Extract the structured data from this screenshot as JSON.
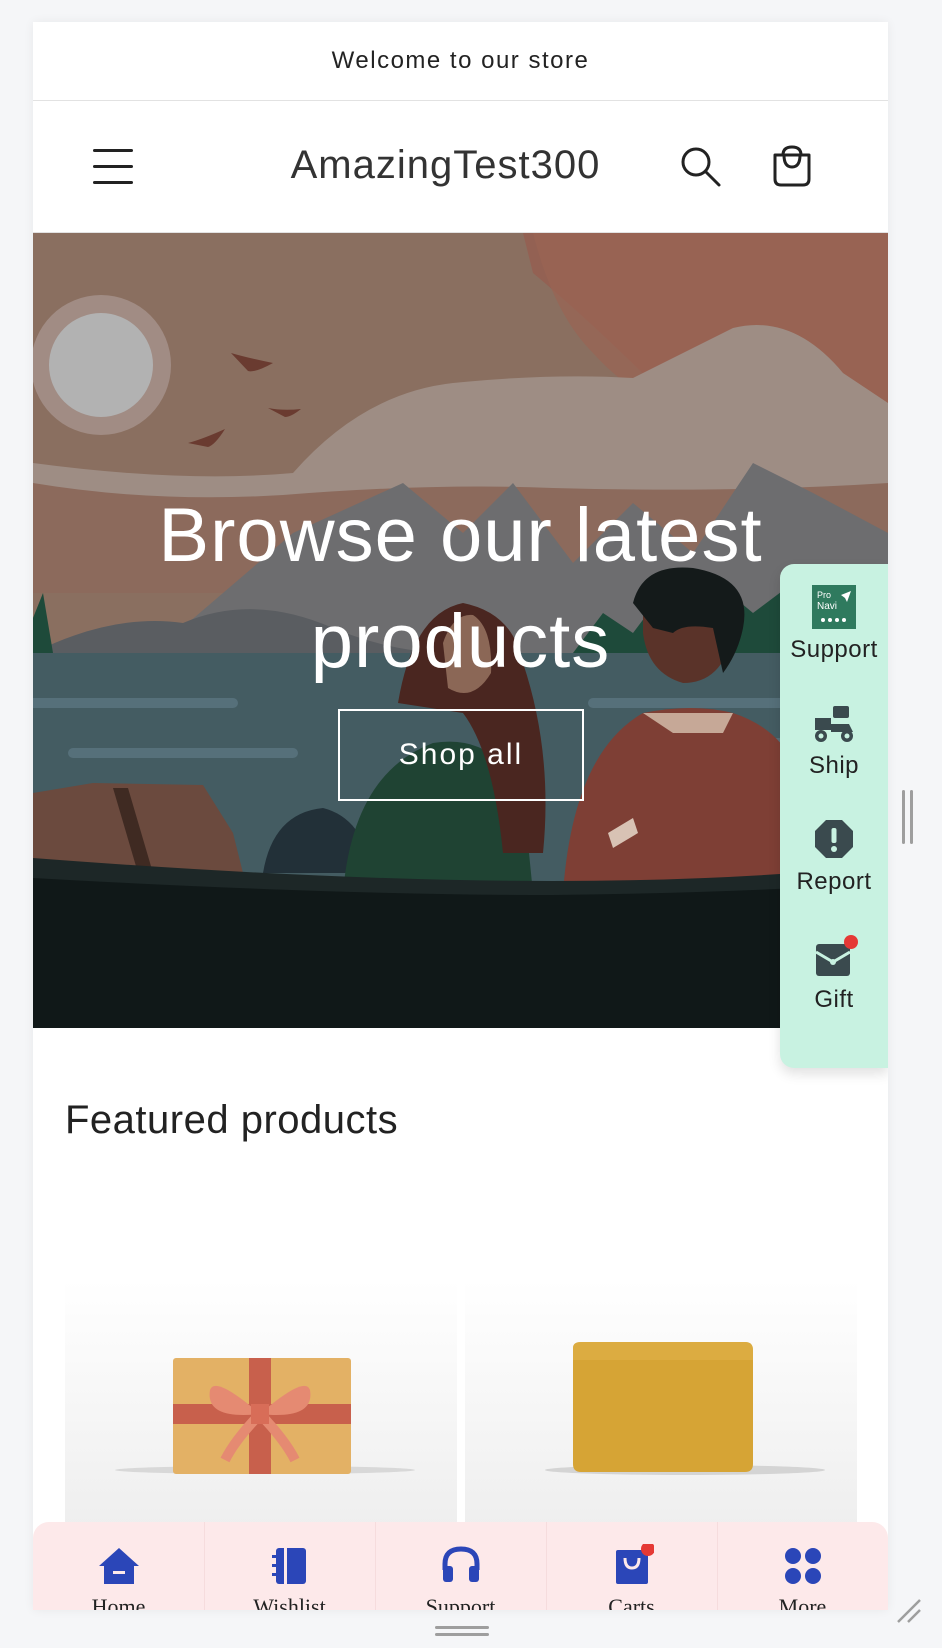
{
  "announcement": {
    "text": "Welcome to our store"
  },
  "header": {
    "brand": "AmazingTest300"
  },
  "hero": {
    "title": "Browse our latest products",
    "button_label": "Shop all"
  },
  "side_widget": {
    "items": [
      {
        "label": "Support",
        "icon": "pronavi-icon",
        "logo_text_top": "Pro",
        "logo_text_bottom": "Navi"
      },
      {
        "label": "Ship",
        "icon": "delivery-scooter-icon"
      },
      {
        "label": "Report",
        "icon": "alert-octagon-icon"
      },
      {
        "label": "Gift",
        "icon": "gift-icon",
        "badge": true
      }
    ],
    "colors": {
      "background": "#c8f2e1",
      "icon": "#3a4a4e",
      "badge": "#e53935"
    }
  },
  "featured": {
    "title": "Featured products",
    "products": [
      {
        "image": "gift-box-image"
      },
      {
        "image": "soap-bar-image"
      }
    ]
  },
  "bottom_nav": {
    "items": [
      {
        "label": "Home",
        "icon": "home-icon"
      },
      {
        "label": "Wishlist",
        "icon": "notebook-icon"
      },
      {
        "label": "Support",
        "icon": "headset-icon"
      },
      {
        "label": "Carts",
        "icon": "shopping-bag-icon",
        "badge": true
      },
      {
        "label": "More",
        "icon": "grid-dots-icon"
      }
    ],
    "colors": {
      "background": "#fde9ea",
      "icon": "#2b46b8",
      "badge": "#e53935"
    }
  }
}
